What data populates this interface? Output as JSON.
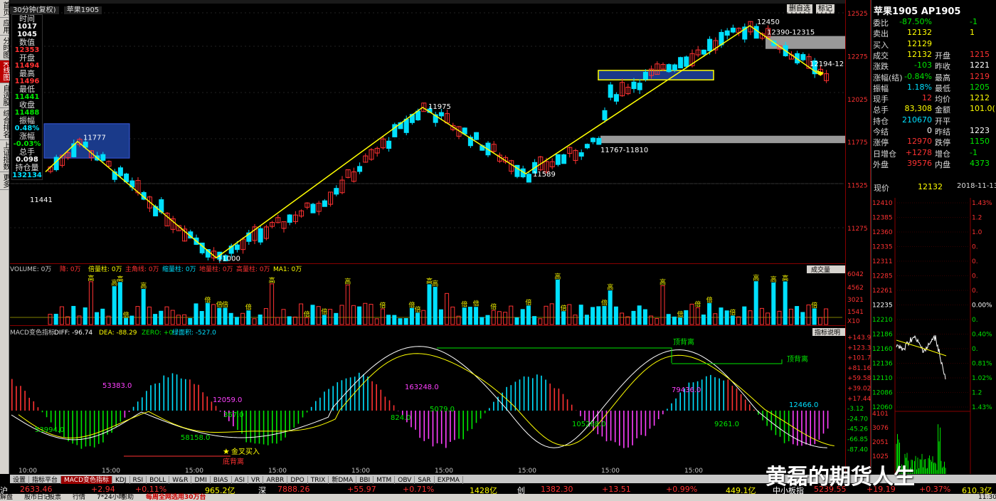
{
  "left_nav": [
    "首页",
    "应用",
    "分时图",
    "K线图",
    "自选股",
    "综合排名",
    "上证指数",
    "更多"
  ],
  "chart_header": {
    "period": "30分钟(复权)",
    "symbol": "苹果1905"
  },
  "toolbar_buttons": [
    "删自选",
    "标记"
  ],
  "info_panel": [
    {
      "label": "时间",
      "value1": "1017",
      "value2": "1045",
      "color": "w"
    },
    {
      "label": "数值",
      "value": "12353",
      "color": "r"
    },
    {
      "label": "开盘",
      "value": "11494",
      "color": "r"
    },
    {
      "label": "最高",
      "value": "11496",
      "color": "r"
    },
    {
      "label": "最低",
      "value": "11441",
      "color": "g"
    },
    {
      "label": "收盘",
      "value": "11488",
      "color": "g"
    },
    {
      "label": "振幅",
      "value": "0.48%",
      "color": "c"
    },
    {
      "label": "涨幅",
      "value": "-0.03%",
      "color": "g"
    },
    {
      "label": "总手",
      "value": "0.098",
      "color": "w"
    },
    {
      "label": "持仓量",
      "value": "132134",
      "color": "c"
    }
  ],
  "price_axis": [
    "12525",
    "12275",
    "12025",
    "11775",
    "11525",
    "11275"
  ],
  "annotations": {
    "p_11777": "11777",
    "p_11441": "11441",
    "p_11000": "11000",
    "p_11975": "11975",
    "p_11589": "11589",
    "p_12450": "12450",
    "zone_top": "12390-12315",
    "zone_mid": "12194-12",
    "zone_low": "11767-11810"
  },
  "volume_header": {
    "items": [
      "VOLUME: 0万",
      "降: 0万",
      "倍量柱: 0万",
      "主角线: 0万",
      "缩量柱: 0万",
      "地量柱: 0万",
      "高量柱: 0万",
      "MA1: 0万"
    ]
  },
  "volume_dropdown": "成交量",
  "volume_axis": [
    "6042",
    "4562",
    "3021",
    "1541",
    "X10"
  ],
  "macd_header": {
    "title": "MACD变色指标",
    "diff": "DIFF: -96.74",
    "dea": "DEA: -88.29",
    "zero": "ZERO: +0",
    "area": "绿面积: -527.0"
  },
  "macd_button": "指标说明",
  "macd_axis": [
    "+143.9",
    "+123.3",
    "+101.7",
    "+81.16",
    "+59.58",
    "+39.02",
    "+17.44",
    "-3.12",
    "-24.70",
    "-45.26",
    "-66.85",
    "-87.40"
  ],
  "macd_labels": {
    "a1": "53383.0",
    "a2": "12059.0",
    "a3": "367.0",
    "a4": "163248.0",
    "a5": "5079.0",
    "a6": "824.0",
    "a7": "79436.0",
    "a8": "12466.0",
    "b1": "53994.0",
    "b2": "58158.0",
    "b3": "105268.0",
    "b4": "9261.0",
    "golden": "金叉买入",
    "bottom_div": "底背离",
    "top_div1": "顶背离",
    "top_div2": "顶背离"
  },
  "time_axis": [
    "10:00",
    "15:00",
    "15:00",
    "15:00",
    "15:00",
    "15:00",
    "15:00",
    "15:00",
    "15:00",
    "15:00"
  ],
  "tabs": [
    "设置",
    "指标平台",
    "MACD变色指标",
    "KDJ",
    "RSI",
    "BOLL",
    "W&R",
    "DMI",
    "BIAS",
    "ASI",
    "VR",
    "ARBR",
    "DPO",
    "TRIX",
    "新DMA",
    "BBI",
    "MTM",
    "OBV",
    "SAR",
    "EXPMA"
  ],
  "quote": {
    "title": "苹果1905 AP1905",
    "rows": [
      {
        "k": "委比",
        "v": "-87.50%",
        "vc": "g",
        "k2": "",
        "v2": "-1",
        "v2c": "g"
      },
      {
        "k": "卖出",
        "v": "12132",
        "vc": "y",
        "k2": "",
        "v2": "1",
        "v2c": "y"
      },
      {
        "k": "买入",
        "v": "12129",
        "vc": "y",
        "k2": "",
        "v2": "",
        "v2c": "y"
      },
      {
        "k": "成交",
        "v": "12132",
        "vc": "y",
        "k2": "开盘",
        "v2": "1215",
        "v2c": "r"
      },
      {
        "k": "涨跌",
        "v": "-103",
        "vc": "g",
        "k2": "昨收",
        "v2": "1221",
        "v2c": "w"
      },
      {
        "k": "涨幅(结)",
        "v": "-0.84%",
        "vc": "g",
        "k2": "最高",
        "v2": "1219",
        "v2c": "r"
      },
      {
        "k": "振幅",
        "v": "1.18%",
        "vc": "c",
        "k2": "最低",
        "v2": "1205",
        "v2c": "g"
      },
      {
        "k": "现手",
        "v": "12",
        "vc": "r",
        "k2": "均价",
        "v2": "1212",
        "v2c": "y"
      },
      {
        "k": "总手",
        "v": "83,308",
        "vc": "y",
        "k2": "金额",
        "v2": "101.0(",
        "v2c": "y"
      },
      {
        "k": "持仓",
        "v": "210670",
        "vc": "c",
        "k2": "开平",
        "v2": "",
        "v2c": "w"
      },
      {
        "k": "今结",
        "v": "0",
        "vc": "w",
        "k2": "昨结",
        "v2": "1223",
        "v2c": "w"
      },
      {
        "k": "涨停",
        "v": "12970",
        "vc": "r",
        "k2": "跌停",
        "v2": "1150",
        "v2c": "g"
      },
      {
        "k": "日增仓",
        "v": "+1278",
        "vc": "r",
        "k2": "增仓",
        "v2": "-1",
        "v2c": "g"
      },
      {
        "k": "外盘",
        "v": "39576",
        "vc": "r",
        "k2": "内盘",
        "v2": "4373",
        "v2c": "g"
      }
    ],
    "last_label": "现价",
    "last_value": "12132",
    "date": "2018-11-13,",
    "intraday_prices": [
      "12410",
      "12385",
      "12360",
      "12335",
      "12311",
      "12285",
      "12261",
      "12235",
      "12210",
      "12186",
      "12160",
      "12136",
      "12110",
      "12086",
      "12060"
    ],
    "intraday_pcts": [
      "1.43%",
      "1.2",
      "1.0",
      "0.",
      "0.",
      "0.",
      "0.",
      "0.00%",
      "0.",
      "0.40%",
      "0.",
      "0.81%",
      "1.02%",
      "1.2",
      "1.43%"
    ],
    "intraday_vol": [
      "4101",
      "3076",
      "2051",
      "1025"
    ]
  },
  "status_bar": {
    "sh": "沪",
    "sh_val": "2633.46",
    "sh_chg": "+2.94",
    "sh_pct": "+0.11%",
    "sh_amt": "965.2亿",
    "sz": "深",
    "sz_val": "7888.26",
    "sz_chg": "+55.97",
    "sz_pct": "+0.71%",
    "sz_amt": "1428亿",
    "cy": "创",
    "cy_val": "1382.30",
    "cy_chg": "+13.51",
    "cy_pct": "+0.99%",
    "cy_amt": "449.1亿",
    "zx": "中小板指",
    "zx_val": "5239.55",
    "zx_chg": "+19.19",
    "zx_pct": "+0.37%",
    "zx_amt": "610.3亿"
  },
  "bottom_bar": [
    "解盘",
    "股市日记",
    "股票",
    "行情",
    "7*24小时",
    "帮助",
    "每周全网选用30万台"
  ],
  "bottom_right": "11:30",
  "watermark": "黄磊的期货人生",
  "colors": {
    "up": "#ff3232",
    "down": "#00e0ff",
    "zigzag": "#ffff00",
    "zone_blue": "#1a3a8a",
    "zone_gray": "#999999",
    "macd_pos": "#ff3232",
    "macd_neg_green": "#00e600",
    "macd_neg_magenta": "#ff40ff",
    "macd_pos_cyan": "#00e0ff",
    "diff": "#ffffff",
    "dea": "#ffff00"
  }
}
